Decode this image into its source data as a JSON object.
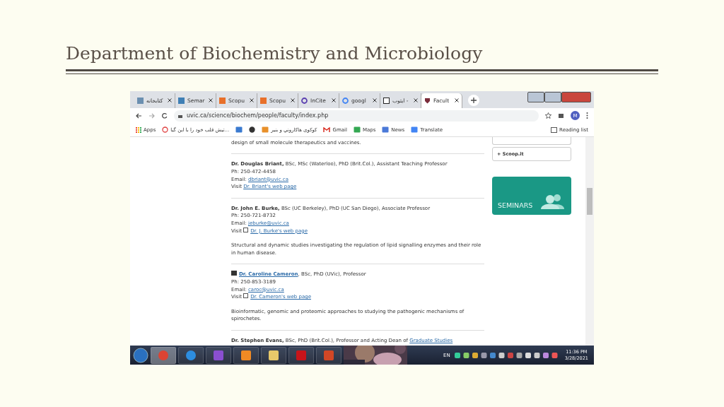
{
  "slide_title": "Department of Biochemistry and Microbiology",
  "browser": {
    "tabs": [
      {
        "label": "کتابخانه",
        "selected": false
      },
      {
        "label": "Semar",
        "selected": false
      },
      {
        "label": "Scopu",
        "selected": false
      },
      {
        "label": "Scopu",
        "selected": false
      },
      {
        "label": "InCite",
        "selected": false
      },
      {
        "label": "googl",
        "selected": false
      },
      {
        "label": "ایتوب -",
        "selected": false
      },
      {
        "label": "Facult",
        "selected": true
      }
    ],
    "address": "uvic.ca/science/biochem/people/faculty/index.php",
    "profile": "M",
    "bookmarks": [
      {
        "label": "Apps"
      },
      {
        "label": "تیش قلب خود را با این گیا..."
      },
      {
        "label": "کوکوی هاکاروني و بنیر"
      },
      {
        "label": "Gmail"
      },
      {
        "label": "Maps"
      },
      {
        "label": "News"
      },
      {
        "label": "Translate"
      }
    ],
    "reading_list": "Reading list",
    "top_fragment": "design of small molecule therapeutics and vaccines.",
    "faculty": [
      {
        "name": "Dr. Douglas Briant,",
        "name_link": false,
        "credentials": " BSc, MSc (Waterloo), PhD (Brit.Col.), Assistant Teaching Professor",
        "phone": "Ph: 250-472-4458",
        "email_label": "Email: ",
        "email": "dbriant@uvic.ca",
        "visit": "Visit ",
        "web_link": "Dr. Briant's web page",
        "external_icon": false
      },
      {
        "name": "Dr. John E. Burke,",
        "name_link": false,
        "credentials": " BSc (UC Berkeley), PhD (UC San Diego), Associate Professor",
        "phone": "Ph: 250-721-8732",
        "email_label": "Email: ",
        "email": "jeburke@uvic.ca",
        "visit": "Visit ",
        "web_link": "Dr. J. Burke's web page",
        "external_icon": true,
        "description": "Structural and dynamic studies investigating the regulation of lipid signalling enzymes and their role in human disease."
      },
      {
        "name": "Dr. Caroline Cameron",
        "name_link": true,
        "credentials": ", BSc, PhD (UVic), Professor",
        "phone": "Ph: 250-853-3189",
        "email_label": "Email: ",
        "email": "caroc@uvic.ca",
        "visit": "Visit ",
        "web_link": "Dr. Cameron's web page",
        "external_icon": true,
        "description": "Bioinformatic, genomic and proteomic approaches to studying the pathogenic mechanisms of spirochetes."
      },
      {
        "name": "Dr. Stephen Evans,",
        "name_link": false,
        "credentials": " BSc, PhD (Brit.Col.), Professor and Acting Dean of ",
        "credentials_link": "Graduate Studies"
      }
    ],
    "sidebar": {
      "link": "+ Scoop.it",
      "banner": "SEMINARS"
    },
    "taskbar": {
      "apps": [
        {
          "selected": true
        },
        {
          "selected": false
        },
        {
          "selected": false
        },
        {
          "selected": false
        },
        {
          "selected": false
        },
        {
          "selected": false
        },
        {
          "selected": false
        }
      ],
      "language": "EN",
      "time": "11:36 PM",
      "date": "3/28/2021"
    }
  }
}
